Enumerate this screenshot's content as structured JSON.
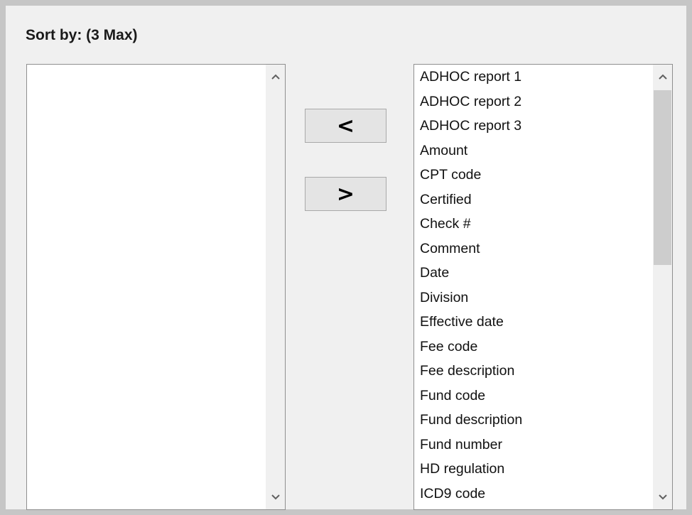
{
  "title": "Sort by: (3 Max)",
  "buttons": {
    "move_left": "<",
    "move_right": ">"
  },
  "selected_list": {
    "items": []
  },
  "available_list": {
    "items": [
      "ADHOC report 1",
      "ADHOC report 2",
      "ADHOC report 3",
      "Amount",
      "CPT code",
      "Certified",
      "Check #",
      "Comment",
      "Date",
      "Division",
      "Effective date",
      "Fee code",
      "Fee description",
      "Fund code",
      "Fund description",
      "Fund number",
      "HD regulation",
      "ICD9 code"
    ]
  },
  "icons": {
    "scroll_up": "chevron-up-icon",
    "scroll_down": "chevron-down-icon"
  },
  "colors": {
    "frame": "#c6c6c6",
    "panel": "#f0f0f0",
    "list_background": "#ffffff",
    "scroll_thumb": "#cdcdcd",
    "button": "#e4e4e4"
  }
}
